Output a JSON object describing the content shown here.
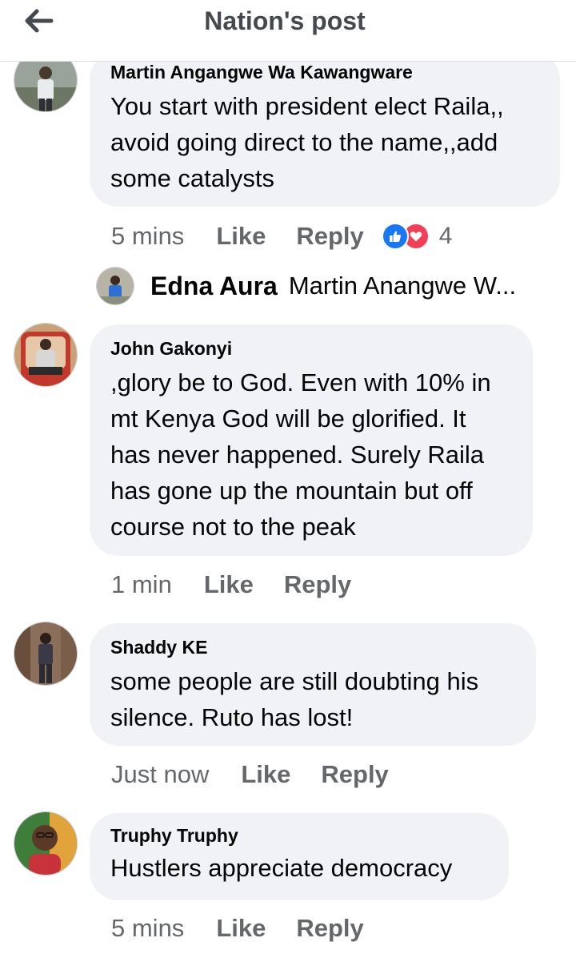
{
  "header": {
    "title": "Nation's post",
    "back_icon": "arrow-left-icon"
  },
  "comments": [
    {
      "author": "Martin Angangwe Wa Kawangware",
      "text": "You start with president elect Raila,,\navoid going direct to the name,,add\nsome catalysts",
      "time": "5 mins",
      "like_label": "Like",
      "reply_label": "Reply",
      "reactions": {
        "icons": [
          "like-icon",
          "love-icon"
        ],
        "count": "4"
      }
    },
    {
      "author": "John Gakonyi",
      "text": ",glory be to God. Even with 10% in\nmt Kenya God will be glorified. It\nhas never happened. Surely Raila\nhas gone up the mountain but off\ncourse not to the peak",
      "time": "1 min",
      "like_label": "Like",
      "reply_label": "Reply"
    },
    {
      "author": "Shaddy KE",
      "text": "some people are still doubting his\nsilence. Ruto has lost!",
      "time": "Just now",
      "like_label": "Like",
      "reply_label": "Reply"
    },
    {
      "author": "Truphy Truphy",
      "text": "Hustlers appreciate democracy",
      "time": "5 mins",
      "like_label": "Like",
      "reply_label": "Reply"
    }
  ],
  "reply_preview": {
    "author": "Edna Aura",
    "snippet": "Martin Anangwe W..."
  },
  "colors": {
    "bubble": "#f0f2f5",
    "secondary_text": "#65676b",
    "like_blue": "#1877f2",
    "love_red": "#f33e58"
  }
}
